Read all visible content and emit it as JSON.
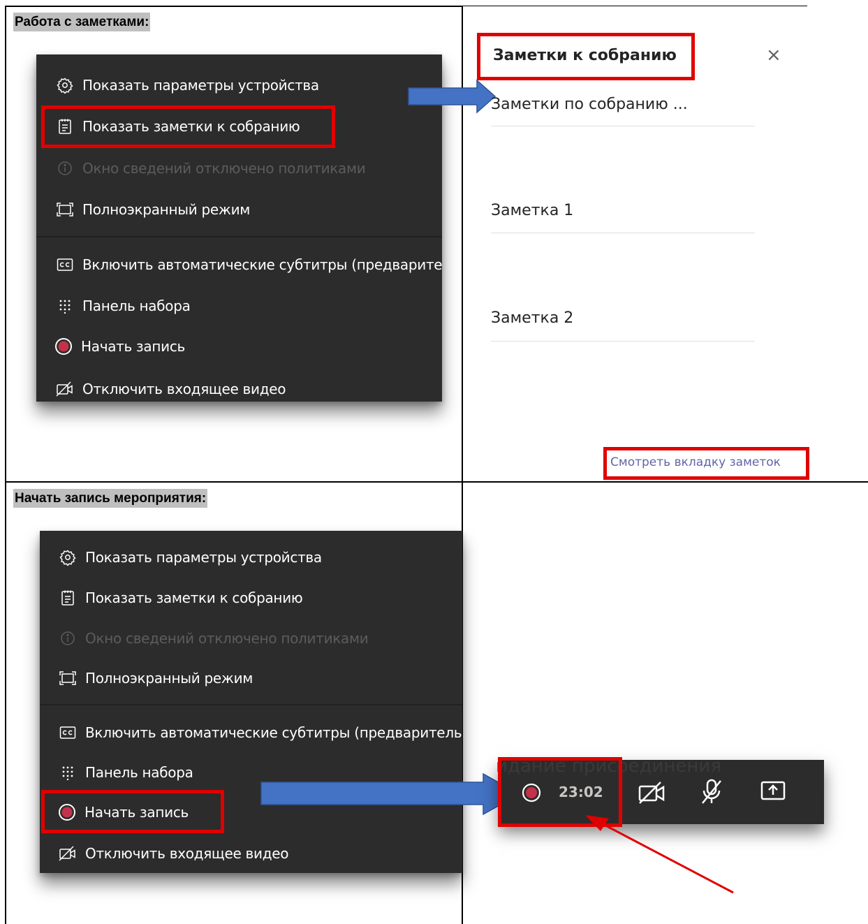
{
  "sections": {
    "notes_heading": "Работа с заметками:",
    "record_heading": "Начать запись мероприятия:"
  },
  "menu": {
    "items": [
      {
        "label": "Показать параметры устройства",
        "icon": "gear-icon"
      },
      {
        "label": "Показать заметки к собранию",
        "icon": "notes-icon"
      },
      {
        "label": "Окно сведений отключено политиками",
        "icon": "info-icon",
        "disabled": true
      },
      {
        "label": "Полноэкранный режим",
        "icon": "fullscreen-icon"
      },
      {
        "label": "Включить автоматические субтитры (предварительная версия)",
        "icon": "captions-icon"
      },
      {
        "label": "Панель набора",
        "icon": "dialpad-icon"
      },
      {
        "label": "Начать запись",
        "icon": "record-icon"
      },
      {
        "label": "Отключить входящее видео",
        "icon": "video-off-icon"
      }
    ]
  },
  "notes_panel": {
    "title": "Заметки к собранию",
    "close": "×",
    "notes": [
      "Заметки по собранию ...",
      "Заметка 1",
      "Заметка 2"
    ],
    "link": "Смотреть вкладку заметок"
  },
  "call_bar": {
    "timer": "23:02",
    "background_text": "идание присоединения"
  },
  "colors": {
    "menu_bg": "#2d2c2c",
    "highlight": "#e00000",
    "arrow_fill": "#4472c4",
    "record": "#c4314b",
    "link": "#6264a7"
  }
}
